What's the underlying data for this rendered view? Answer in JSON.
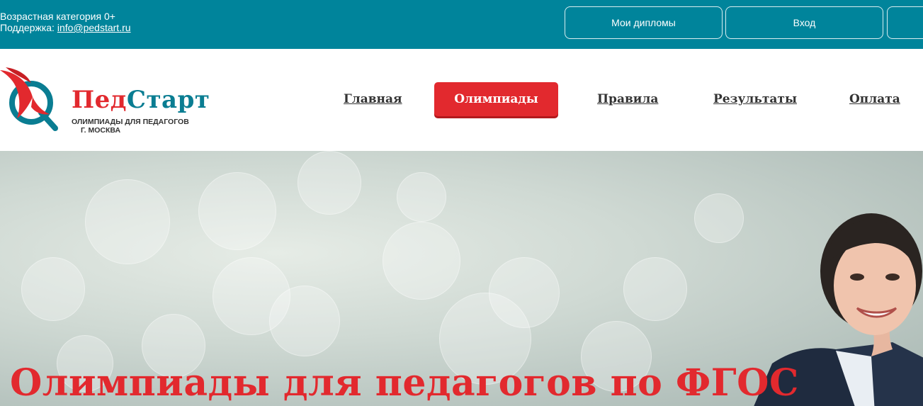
{
  "topbar": {
    "age_category": "Возрастная категория 0+",
    "support_label": "Поддержка: ",
    "support_email": "info@pedstart.ru",
    "buttons": [
      {
        "label": "Мои дипломы"
      },
      {
        "label": "Вход"
      },
      {
        "label": ""
      }
    ]
  },
  "header": {
    "logo": {
      "brand_part1": "Пед",
      "brand_part2": "Старт",
      "tagline_line1": "ОЛИМПИАДЫ ДЛЯ ПЕДАГОГОВ",
      "tagline_line2": "Г. МОСКВА"
    },
    "nav": [
      {
        "label": "Главная",
        "active": false
      },
      {
        "label": "Олимпиады",
        "active": true
      },
      {
        "label": "Правила",
        "active": false
      },
      {
        "label": "Результаты",
        "active": false
      },
      {
        "label": "Оплата",
        "active": false
      }
    ]
  },
  "hero": {
    "title": "Олимпиады для педагогов по ФГОС"
  },
  "colors": {
    "topbar_bg": "#00849b",
    "accent_red": "#e2292e",
    "brand_teal": "#0a7d92"
  },
  "icons": [
    "logo-feather-icon"
  ]
}
